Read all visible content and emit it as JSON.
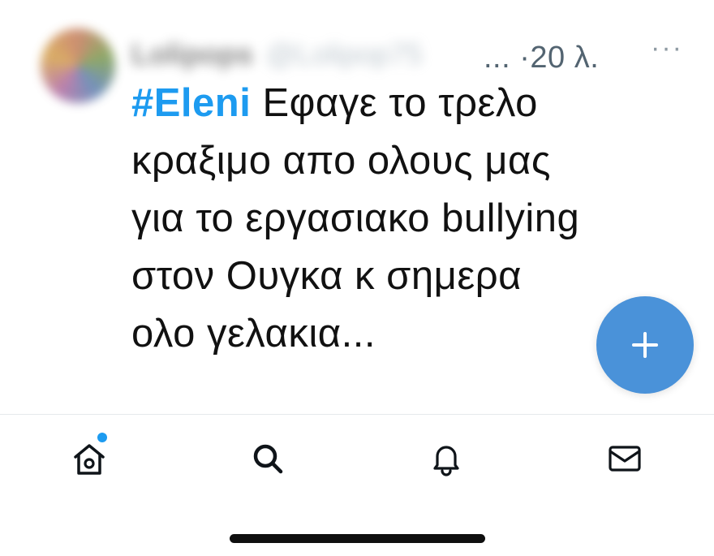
{
  "tweet": {
    "author_name": "Lolipops",
    "author_handle": "@Lolipop75",
    "truncation": "...",
    "separator": "·",
    "timestamp": "20 λ.",
    "more_label": "···",
    "hashtag": "#Eleni",
    "text": " Εφαγε το τρελο\nκραξιμο απο ολους μας\nγια το εργασιακο bullying\nστον Ουγκα κ σημερα\nολο γελακια..."
  },
  "fab": {
    "icon": "plus-icon",
    "color": "#4a92d9"
  },
  "nav": {
    "items": [
      {
        "icon": "home-icon",
        "has_notification_dot": true
      },
      {
        "icon": "search-icon",
        "has_notification_dot": false
      },
      {
        "icon": "bell-icon",
        "has_notification_dot": false
      },
      {
        "icon": "envelope-icon",
        "has_notification_dot": false
      }
    ],
    "accent_color": "#1d9bf0"
  }
}
